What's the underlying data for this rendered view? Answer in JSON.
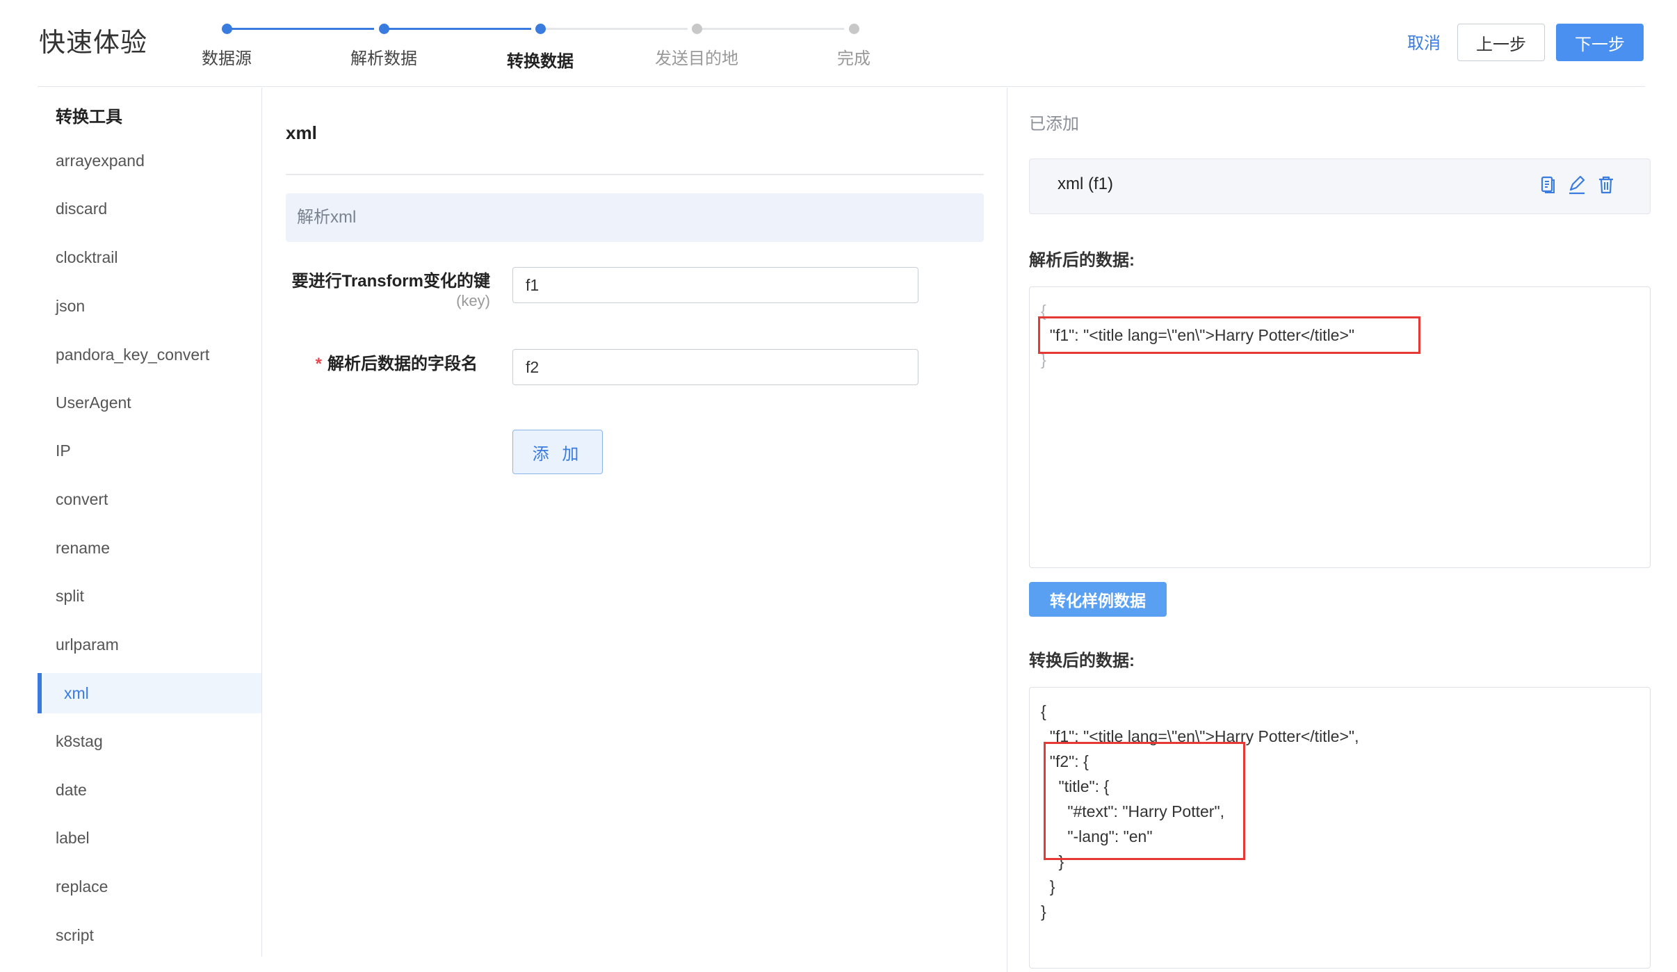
{
  "header": {
    "title": "快速体验",
    "steps": [
      {
        "label": "数据源",
        "status": "done"
      },
      {
        "label": "解析数据",
        "status": "done"
      },
      {
        "label": "转换数据",
        "status": "current"
      },
      {
        "label": "发送目的地",
        "status": "pending"
      },
      {
        "label": "完成",
        "status": "pending"
      }
    ],
    "cancel_label": "取消",
    "prev_label": "上一步",
    "next_label": "下一步"
  },
  "sidebar": {
    "title": "转换工具",
    "items": [
      {
        "label": "arrayexpand"
      },
      {
        "label": "discard"
      },
      {
        "label": "clocktrail"
      },
      {
        "label": "json"
      },
      {
        "label": "pandora_key_convert"
      },
      {
        "label": "UserAgent"
      },
      {
        "label": "IP"
      },
      {
        "label": "convert"
      },
      {
        "label": "rename"
      },
      {
        "label": "split"
      },
      {
        "label": "urlparam"
      },
      {
        "label": "xml",
        "active": true
      },
      {
        "label": "k8stag"
      },
      {
        "label": "date"
      },
      {
        "label": "label"
      },
      {
        "label": "replace"
      },
      {
        "label": "script"
      }
    ]
  },
  "form": {
    "title": "xml",
    "description": "解析xml",
    "key_label": "要进行Transform变化的键",
    "key_sublabel": "(key)",
    "key_value": "f1",
    "new_field_label": "解析后数据的字段名",
    "new_field_required_mark": "*",
    "new_field_value": "f2",
    "add_label": "添 加"
  },
  "right": {
    "added_label": "已添加",
    "added_item": "xml (f1)",
    "parsed_title": "解析后的数据:",
    "parsed_lines": [
      "{",
      "  \"f1\": \"<title lang=\\\"en\\\">Harry Potter</title>\"",
      "}"
    ],
    "convert_button": "转化样例数据",
    "converted_title": "转换后的数据:",
    "converted_lines": [
      "{",
      "  \"f1\": \"<title lang=\\\"en\\\">Harry Potter</title>\",",
      "  \"f2\": {",
      "    \"title\": {",
      "      \"#text\": \"Harry Potter\",",
      "      \"-lang\": \"en\"",
      "    }",
      "  }",
      "}"
    ]
  },
  "colors": {
    "accent": "#3a7be0",
    "primary_button": "#4a90f0",
    "highlight_box": "#e53935",
    "pending_step": "#c8c8c8"
  }
}
